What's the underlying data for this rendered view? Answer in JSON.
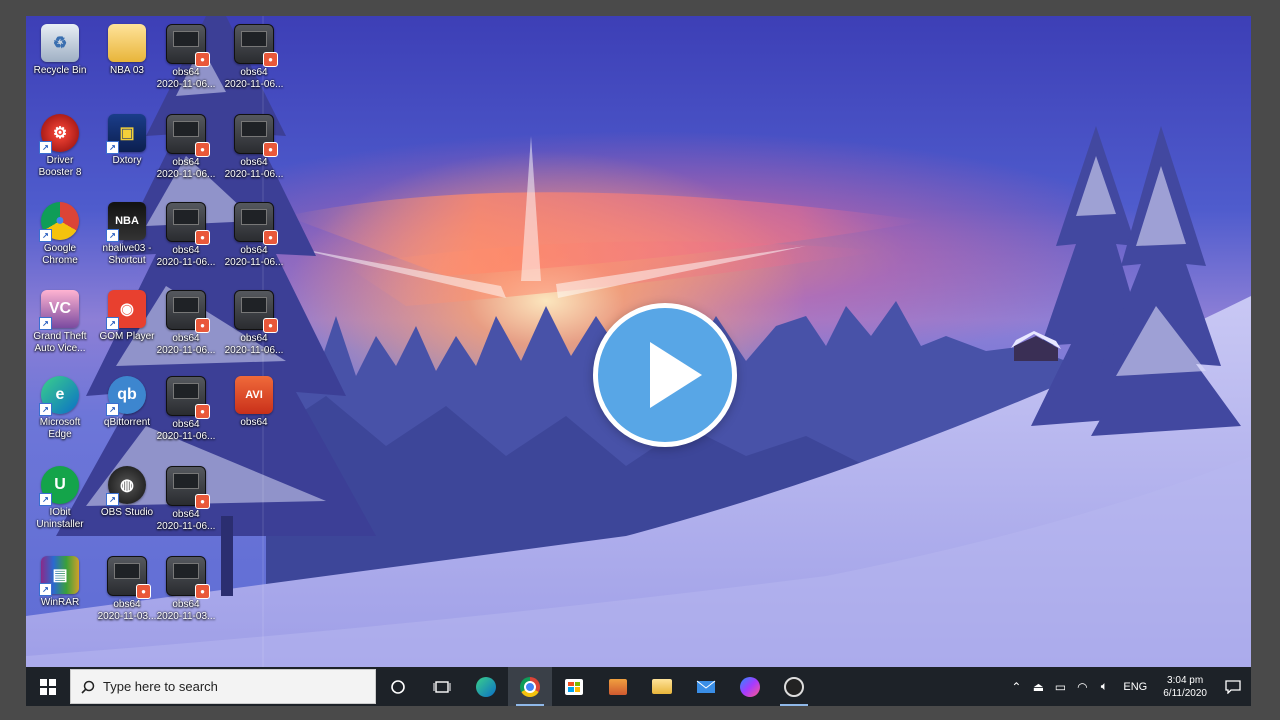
{
  "desktop": {
    "icons": [
      {
        "label": "Recycle Bin",
        "icon": "recycle-bin-icon"
      },
      {
        "label": "NBA 03",
        "icon": "folder-icon"
      },
      {
        "label": "obs64\n2020-11-06...",
        "icon": "obs-video-icon"
      },
      {
        "label": "obs64\n2020-11-06...",
        "icon": "obs-video-icon"
      },
      {
        "label": "Driver\nBooster 8",
        "icon": "driver-booster-icon"
      },
      {
        "label": "Dxtory",
        "icon": "dxtory-icon"
      },
      {
        "label": "obs64\n2020-11-06...",
        "icon": "obs-video-icon"
      },
      {
        "label": "obs64\n2020-11-06...",
        "icon": "obs-video-icon"
      },
      {
        "label": "Google\nChrome",
        "icon": "chrome-icon"
      },
      {
        "label": "nbalive03 -\nShortcut",
        "icon": "nba-live-icon"
      },
      {
        "label": "obs64\n2020-11-06...",
        "icon": "obs-video-icon"
      },
      {
        "label": "obs64\n2020-11-06...",
        "icon": "obs-video-icon"
      },
      {
        "label": "Grand Theft\nAuto Vice...",
        "icon": "gta-icon"
      },
      {
        "label": "GOM Player",
        "icon": "gom-player-icon"
      },
      {
        "label": "obs64\n2020-11-06...",
        "icon": "obs-video-icon"
      },
      {
        "label": "obs64\n2020-11-06...",
        "icon": "obs-video-icon"
      },
      {
        "label": "Microsoft\nEdge",
        "icon": "edge-icon"
      },
      {
        "label": "qBittorrent",
        "icon": "qbittorrent-icon"
      },
      {
        "label": "obs64\n2020-11-06...",
        "icon": "obs-video-icon"
      },
      {
        "label": "obs64",
        "icon": "avi-file-icon"
      },
      {
        "label": "IObit\nUninstaller",
        "icon": "iobit-icon"
      },
      {
        "label": "OBS Studio",
        "icon": "obs-studio-icon"
      },
      {
        "label": "obs64\n2020-11-06...",
        "icon": "obs-video-icon"
      },
      {
        "label": "WinRAR",
        "icon": "winrar-icon"
      },
      {
        "label": "obs64\n2020-11-03...",
        "icon": "obs-video-icon"
      },
      {
        "label": "obs64\n2020-11-03...",
        "icon": "obs-video-icon"
      }
    ]
  },
  "player": {
    "icon": "play-icon"
  },
  "taskbar": {
    "search_placeholder": "Type here to search",
    "pinned": [
      {
        "name": "cortana",
        "icon": "cortana-icon"
      },
      {
        "name": "task-view",
        "icon": "task-view-icon"
      },
      {
        "name": "edge",
        "icon": "edge-icon"
      },
      {
        "name": "chrome",
        "icon": "chrome-icon"
      },
      {
        "name": "store",
        "icon": "store-icon"
      },
      {
        "name": "media-player",
        "icon": "media-player-icon"
      },
      {
        "name": "file-explorer",
        "icon": "folder-icon"
      },
      {
        "name": "mail",
        "icon": "mail-icon"
      },
      {
        "name": "messenger",
        "icon": "messenger-icon"
      },
      {
        "name": "obs-studio",
        "icon": "obs-studio-icon"
      }
    ],
    "tray": {
      "language": "ENG",
      "time": "3:04 pm",
      "date": "6/11/2020"
    }
  }
}
